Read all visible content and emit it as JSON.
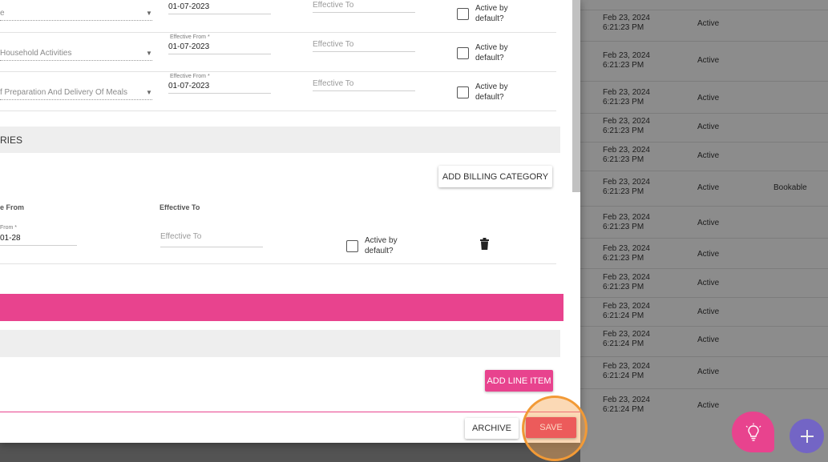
{
  "background_table": {
    "rows": [
      {
        "date": "",
        "time": "",
        "status": "",
        "tag": ""
      },
      {
        "date": "Feb 23, 2024",
        "time": "6:21:23 PM",
        "status": "Active",
        "tag": ""
      },
      {
        "date": "Feb 23, 2024",
        "time": "6:21:23 PM",
        "status": "Active",
        "tag": ""
      },
      {
        "date": "Feb 23, 2024",
        "time": "6:21:23 PM",
        "status": "Active",
        "tag": ""
      },
      {
        "date": "Feb 23, 2024",
        "time": "6:21:23 PM",
        "status": "Active",
        "tag": ""
      },
      {
        "date": "Feb 23, 2024",
        "time": "6:21:23 PM",
        "status": "Active",
        "tag": ""
      },
      {
        "date": "Feb 23, 2024",
        "time": "6:21:23 PM",
        "status": "Active",
        "tag": "Bookable"
      },
      {
        "date": "Feb 23, 2024",
        "time": "6:21:23 PM",
        "status": "Active",
        "tag": ""
      },
      {
        "date": "Feb 23, 2024",
        "time": "6:21:23 PM",
        "status": "Active",
        "tag": ""
      },
      {
        "date": "Feb 23, 2024",
        "time": "6:21:23 PM",
        "status": "Active",
        "tag": ""
      },
      {
        "date": "Feb 23, 2024",
        "time": "6:21:24 PM",
        "status": "Active",
        "tag": ""
      },
      {
        "date": "Feb 23, 2024",
        "time": "6:21:24 PM",
        "status": "Active",
        "tag": ""
      },
      {
        "date": "Feb 23, 2024",
        "time": "6:21:24 PM",
        "status": "Active",
        "tag": ""
      },
      {
        "date": "Feb 23, 2024",
        "time": "6:21:24 PM",
        "status": "Active",
        "tag": ""
      }
    ]
  },
  "services": [
    {
      "name": "e",
      "effective_from_label": "",
      "effective_from": "01-07-2023",
      "effective_to_placeholder": "Effective To",
      "active_label": "Active by default?"
    },
    {
      "name": "Household Activities",
      "effective_from_label": "Effective From *",
      "effective_from": "01-07-2023",
      "effective_to_placeholder": "Effective To",
      "active_label": "Active by default?"
    },
    {
      "name": "f Preparation And Delivery Of Meals",
      "effective_from_label": "Effective From *",
      "effective_from": "01-07-2023",
      "effective_to_placeholder": "Effective To",
      "active_label": "Active by default?"
    }
  ],
  "billing": {
    "section_title": "RIES",
    "add_button": "ADD BILLING CATEGORY",
    "col_from": "e From",
    "col_to": "Effective To",
    "row": {
      "from_label": "From *",
      "from_value": "01-28",
      "to_placeholder": "Effective To",
      "active_label": "Active by default?"
    }
  },
  "line_items": {
    "add_button": "ADD LINE ITEM"
  },
  "footer": {
    "archive": "ARCHIVE",
    "save": "SAVE"
  },
  "colors": {
    "accent_pink": "#e8438e",
    "fab_purple": "#6f5fcf",
    "save_red": "#ec5b5b",
    "highlight_orange": "#f29a36"
  },
  "icons": {
    "delete": "trash-icon",
    "idea": "lightbulb-icon",
    "add": "plus-icon"
  }
}
